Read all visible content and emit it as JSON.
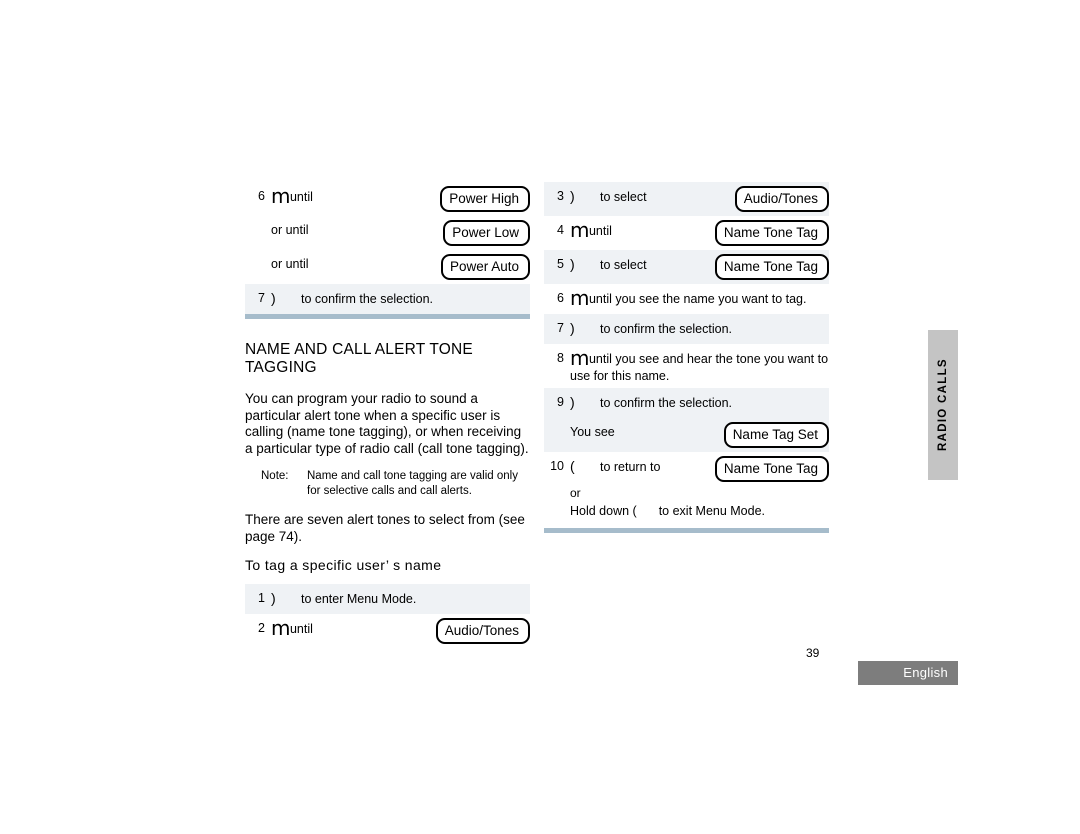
{
  "document": {
    "page_number": "39",
    "language_tab": "English",
    "side_tab": "RADIO CALLS"
  },
  "left_column": {
    "steps_top": [
      {
        "num": "6",
        "key": "m",
        "text": "until",
        "lcd": "Power High",
        "shaded": false
      },
      {
        "num": "",
        "key": "",
        "text": "or until",
        "lcd": "Power Low",
        "shaded": false
      },
      {
        "num": "",
        "key": "",
        "text": "or until",
        "lcd": "Power Auto",
        "shaded": false
      },
      {
        "num": "7",
        "key": ")",
        "text": "to confirm the selection.",
        "lcd": "",
        "shaded": true
      }
    ],
    "section_title": "NAME AND CALL ALERT TONE TAGGING",
    "body_paragraph": "You can program your radio to sound a particular alert tone when a specific user is calling (name tone tagging), or when receiving a particular type of radio call (call tone tagging).",
    "note_label": "Note:",
    "note_text": "Name and call tone tagging are valid only for selective calls and call alerts.",
    "body_paragraph_2": "There are seven alert tones to select from (see page 74).",
    "subheading": "To tag a specific user’ s name",
    "steps_bottom": [
      {
        "num": "1",
        "key": ")",
        "text": "to enter Menu Mode.",
        "lcd": "",
        "shaded": true
      },
      {
        "num": "2",
        "key": "m",
        "text": "until",
        "lcd": "Audio/Tones",
        "shaded": false
      }
    ]
  },
  "right_column": {
    "steps": [
      {
        "num": "3",
        "key": ")",
        "text": "to select",
        "lcd": "Audio/Tones",
        "shaded": true
      },
      {
        "num": "4",
        "key": "m",
        "text": "until",
        "lcd": "Name Tone Tag",
        "shaded": false
      },
      {
        "num": "5",
        "key": ")",
        "text": "to select",
        "lcd": "Name Tone Tag",
        "shaded": true
      },
      {
        "num": "6",
        "key": "m",
        "text": "until you see the name you want to tag.",
        "lcd": "",
        "shaded": false
      },
      {
        "num": "7",
        "key": ")",
        "text": "to confirm the selection.",
        "lcd": "",
        "shaded": true
      },
      {
        "num": "8",
        "key": "m",
        "text": "until you see and hear the tone you want to use for this name.",
        "lcd": "",
        "shaded": false
      },
      {
        "num": "9",
        "key": ")",
        "text": "to confirm the selection.",
        "lcd": "",
        "shaded": true
      }
    ],
    "you_see_label": "You see",
    "you_see_lcd": "Name Tag Set",
    "step10": {
      "num": "10",
      "key": "(",
      "text": "to return to",
      "lcd": "Name Tone Tag"
    },
    "step10_or": "or",
    "step10_hold": "Hold down (",
    "step10_hold_rest": "to exit Menu Mode."
  },
  "colors": {
    "row_shade": "#eff2f5",
    "rule": "#a6bccb",
    "side_tab": "#c4c4c4",
    "lang_tab": "#7d7d7d"
  }
}
